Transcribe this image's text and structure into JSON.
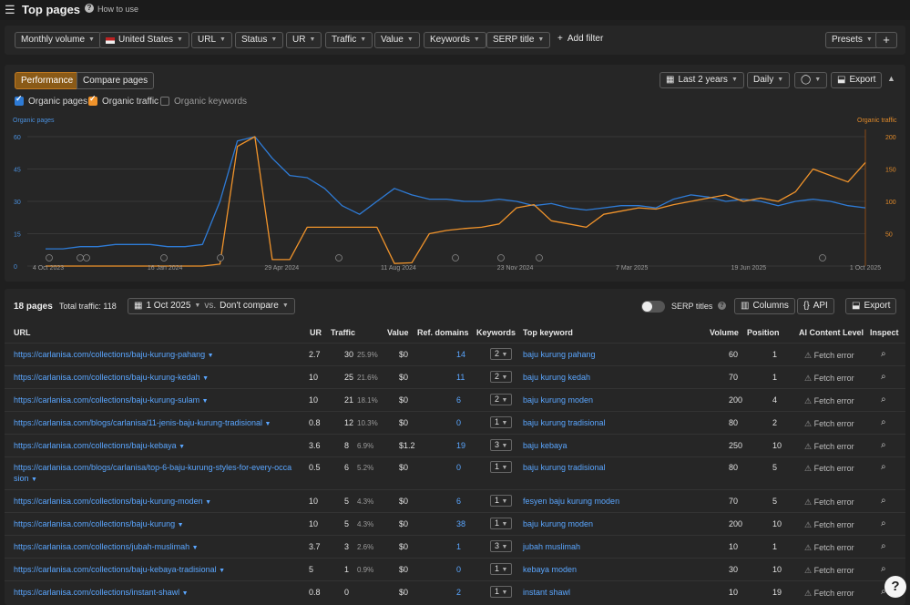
{
  "header": {
    "title": "Top pages",
    "howto": "How to use"
  },
  "filters": {
    "items": [
      "Monthly volume",
      "United States",
      "URL",
      "Status",
      "UR",
      "Traffic",
      "Value",
      "Keywords",
      "SERP title"
    ],
    "add_filter": "Add filter",
    "presets": "Presets",
    "plus": "+"
  },
  "performance": {
    "tabs": [
      "Performance",
      "Compare pages"
    ],
    "period": "Last 2 years",
    "granularity": "Daily",
    "export": "Export",
    "legend": [
      "Organic pages",
      "Organic traffic",
      "Organic keywords"
    ],
    "axis_left_label": "Organic pages",
    "axis_right_label": "Organic traffic"
  },
  "chart_data": {
    "type": "line",
    "x": [
      "4 Oct 2023",
      "16 Jan 2024",
      "29 Apr 2024",
      "11 Aug 2024",
      "23 Nov 2024",
      "7 Mar 2025",
      "19 Jun 2025",
      "1 Oct 2025"
    ],
    "y_left_ticks": [
      0,
      15,
      30,
      45,
      60
    ],
    "y_right_ticks": [
      50,
      100,
      150,
      200
    ],
    "ylim_left": [
      0,
      60
    ],
    "ylim_right": [
      0,
      200
    ],
    "legend_position": "top-left",
    "grid": true,
    "series": [
      {
        "name": "Organic pages",
        "axis": "left",
        "color": "#2e7bd6",
        "values": [
          8,
          8,
          9,
          9,
          10,
          10,
          10,
          9,
          9,
          10,
          30,
          58,
          60,
          50,
          42,
          41,
          36,
          28,
          24,
          30,
          36,
          33,
          31,
          31,
          30,
          30,
          31,
          30,
          28,
          29,
          27,
          26,
          27,
          28,
          28,
          27,
          31,
          33,
          32,
          30,
          31,
          30,
          28,
          30,
          31,
          30,
          28,
          27
        ]
      },
      {
        "name": "Organic traffic",
        "axis": "right",
        "color": "#f0932b",
        "values": [
          0,
          0,
          0,
          0,
          0,
          0,
          0,
          0,
          0,
          0,
          3,
          185,
          200,
          10,
          10,
          60,
          60,
          60,
          60,
          60,
          4,
          5,
          50,
          55,
          58,
          60,
          65,
          90,
          95,
          70,
          65,
          60,
          80,
          85,
          90,
          88,
          95,
          100,
          105,
          110,
          100,
          105,
          100,
          115,
          150,
          140,
          130,
          160
        ]
      }
    ]
  },
  "table": {
    "summary": "18 pages",
    "total_traffic": "Total traffic: 118",
    "date": "1 Oct 2025",
    "vs": "vs.",
    "compare": "Don't compare",
    "serp_titles": "SERP titles",
    "columns_btn": "Columns",
    "api_btn": "API",
    "export_btn": "Export",
    "headers": [
      "URL",
      "UR",
      "Traffic",
      "Value",
      "Ref. domains",
      "Keywords",
      "Top keyword",
      "Volume",
      "Position",
      "AI Content Level",
      "Inspect"
    ],
    "rows": [
      {
        "url": "https://carlanisa.com/collections/baju-kurung-pahang",
        "ur": "2.7",
        "traffic": "30",
        "pct": "25.9%",
        "value": "$0",
        "refdomains": "14",
        "keywords": "2",
        "top_keyword": "baju kurung pahang",
        "volume": "60",
        "position": "1",
        "ai": "Fetch error"
      },
      {
        "url": "https://carlanisa.com/collections/baju-kurung-kedah",
        "ur": "10",
        "traffic": "25",
        "pct": "21.6%",
        "value": "$0",
        "refdomains": "11",
        "keywords": "2",
        "top_keyword": "baju kurung kedah",
        "volume": "70",
        "position": "1",
        "ai": "Fetch error"
      },
      {
        "url": "https://carlanisa.com/collections/baju-kurung-sulam",
        "ur": "10",
        "traffic": "21",
        "pct": "18.1%",
        "value": "$0",
        "refdomains": "6",
        "keywords": "2",
        "top_keyword": "baju kurung moden",
        "volume": "200",
        "position": "4",
        "ai": "Fetch error"
      },
      {
        "url": "https://carlanisa.com/blogs/carlanisa/11-jenis-baju-kurung-tradisional",
        "ur": "0.8",
        "traffic": "12",
        "pct": "10.3%",
        "value": "$0",
        "refdomains": "0",
        "keywords": "1",
        "top_keyword": "baju kurung tradisional",
        "volume": "80",
        "position": "2",
        "ai": "Fetch error"
      },
      {
        "url": "https://carlanisa.com/collections/baju-kebaya",
        "ur": "3.6",
        "traffic": "8",
        "pct": "6.9%",
        "value": "$1.2",
        "refdomains": "19",
        "keywords": "3",
        "top_keyword": "baju kebaya",
        "volume": "250",
        "position": "10",
        "ai": "Fetch error"
      },
      {
        "url": "https://carlanisa.com/blogs/carlanisa/top-6-baju-kurung-styles-for-every-occa",
        "url2": "sion",
        "ur": "0.5",
        "traffic": "6",
        "pct": "5.2%",
        "value": "$0",
        "refdomains": "0",
        "keywords": "1",
        "top_keyword": "baju kurung tradisional",
        "volume": "80",
        "position": "5",
        "ai": "Fetch error"
      },
      {
        "url": "https://carlanisa.com/collections/baju-kurung-moden",
        "ur": "10",
        "traffic": "5",
        "pct": "4.3%",
        "value": "$0",
        "refdomains": "6",
        "keywords": "1",
        "top_keyword": "fesyen baju kurung moden",
        "volume": "70",
        "position": "5",
        "ai": "Fetch error"
      },
      {
        "url": "https://carlanisa.com/collections/baju-kurung",
        "ur": "10",
        "traffic": "5",
        "pct": "4.3%",
        "value": "$0",
        "refdomains": "38",
        "keywords": "1",
        "top_keyword": "baju kurung moden",
        "volume": "200",
        "position": "10",
        "ai": "Fetch error"
      },
      {
        "url": "https://carlanisa.com/collections/jubah-muslimah",
        "ur": "3.7",
        "traffic": "3",
        "pct": "2.6%",
        "value": "$0",
        "refdomains": "1",
        "keywords": "3",
        "top_keyword": "jubah muslimah",
        "volume": "10",
        "position": "1",
        "ai": "Fetch error"
      },
      {
        "url": "https://carlanisa.com/collections/baju-kebaya-tradisional",
        "ur": "5",
        "traffic": "1",
        "pct": "0.9%",
        "value": "$0",
        "refdomains": "0",
        "keywords": "1",
        "top_keyword": "kebaya moden",
        "volume": "30",
        "position": "10",
        "ai": "Fetch error"
      },
      {
        "url": "https://carlanisa.com/collections/instant-shawl",
        "ur": "0.8",
        "traffic": "0",
        "pct": "",
        "value": "$0",
        "refdomains": "2",
        "keywords": "1",
        "top_keyword": "instant shawl",
        "volume": "10",
        "position": "19",
        "ai": "Fetch error"
      }
    ]
  },
  "help": "?"
}
